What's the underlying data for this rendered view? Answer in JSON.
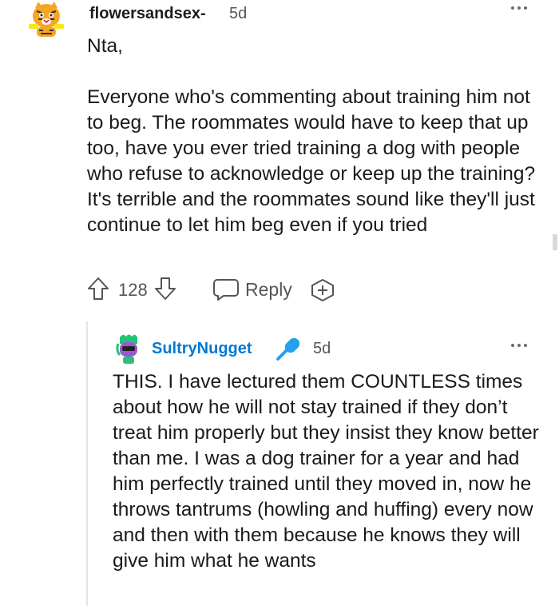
{
  "comment": {
    "username": "flowersandsex-",
    "age": "5d",
    "avatar_icon": "tiger-snoo-avatar-icon",
    "paragraphs": [
      "Nta,",
      "Everyone who's commenting about training him not to beg. The roommates would have to keep that up too, have you ever tried training a dog with people who refuse to acknowledge or keep up the training? It's terrible and the roommates sound like they'll just continue to let him beg even if you tried"
    ],
    "score": "128",
    "reply_label": "Reply"
  },
  "reply": {
    "username": "SultryNugget",
    "age": "5d",
    "avatar_icon": "purple-snoo-avatar-icon",
    "badge_icon": "microphone-icon",
    "username_color": "#0079d3",
    "text": "THIS. I have lectured them COUNTLESS times about how he will not stay trained if they don’t treat him properly but they insist they know better than me. I was a dog trainer for a year and had him perfectly trained until they moved in, now he throws tantrums (howling and huffing) every now and then with them because he knows they will give him what he wants"
  }
}
